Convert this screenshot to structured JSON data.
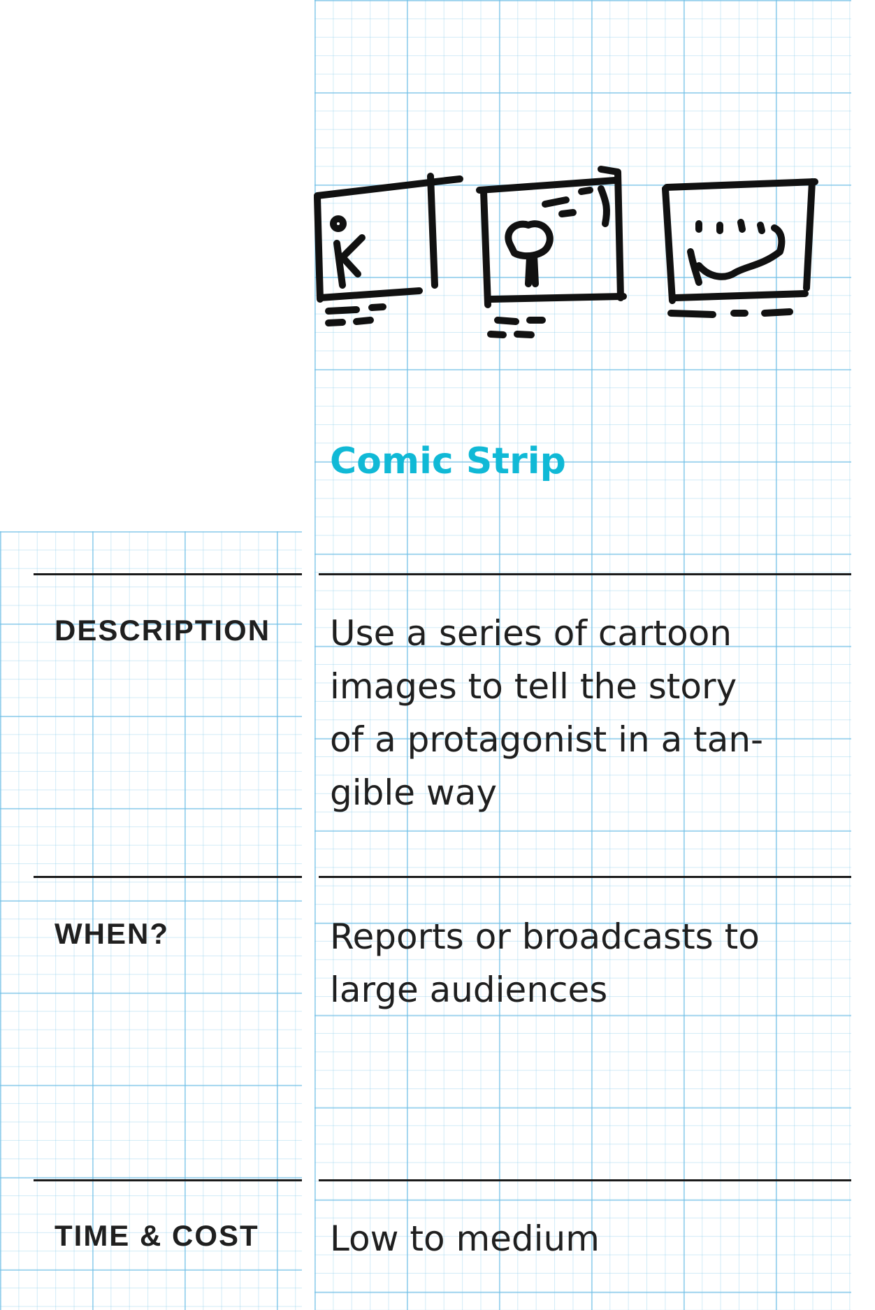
{
  "card": {
    "title": "Comic Strip",
    "accent_color": "#10b9d6",
    "illustration": "comic-strip-sketch-icon",
    "sections": [
      {
        "label": "DESCRIPTION",
        "value": "Use a series of cartoon images to tell the story of a protagonist in a tan-gible way"
      },
      {
        "label": "WHEN?",
        "value": "Reports or broadcasts to large audiences"
      },
      {
        "label": "TIME & COST",
        "value": "Low to medium"
      }
    ]
  }
}
